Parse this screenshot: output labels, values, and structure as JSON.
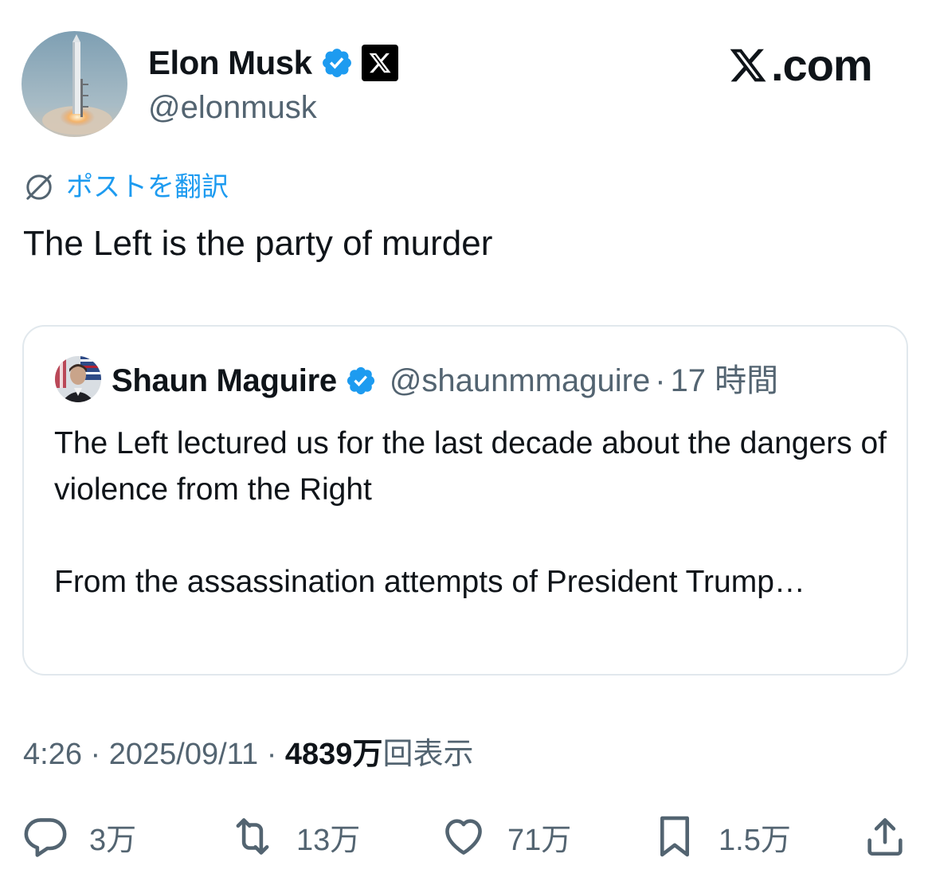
{
  "author": {
    "name": "Elon Musk",
    "handle": "@elonmusk",
    "verified": true,
    "affiliation_badge": "x-logo"
  },
  "brand": {
    "label": ".com",
    "logo": "x-logo"
  },
  "translate_label": "ポストを翻訳",
  "tweet_text": "The Left is the party of murder",
  "quote": {
    "name": "Shaun Maguire",
    "handle": "@shaunmmaguire",
    "separator": "·",
    "time": "17 時間",
    "paragraphs": [
      "The Left lectured us for the last decade about the dangers of violence from the Right",
      "From the assassination attempts of President Trump…"
    ]
  },
  "meta": {
    "time": "4:26",
    "separator": "·",
    "date": "2025/09/11",
    "views_count": "4839万",
    "views_label": "回表示"
  },
  "actions": {
    "replies": "3万",
    "reposts": "13万",
    "likes": "71万",
    "bookmarks": "1.5万"
  },
  "colors": {
    "accent": "#1d9bf0",
    "text": "#0f1419",
    "secondary": "#536471",
    "border": "#e1e8ed"
  }
}
